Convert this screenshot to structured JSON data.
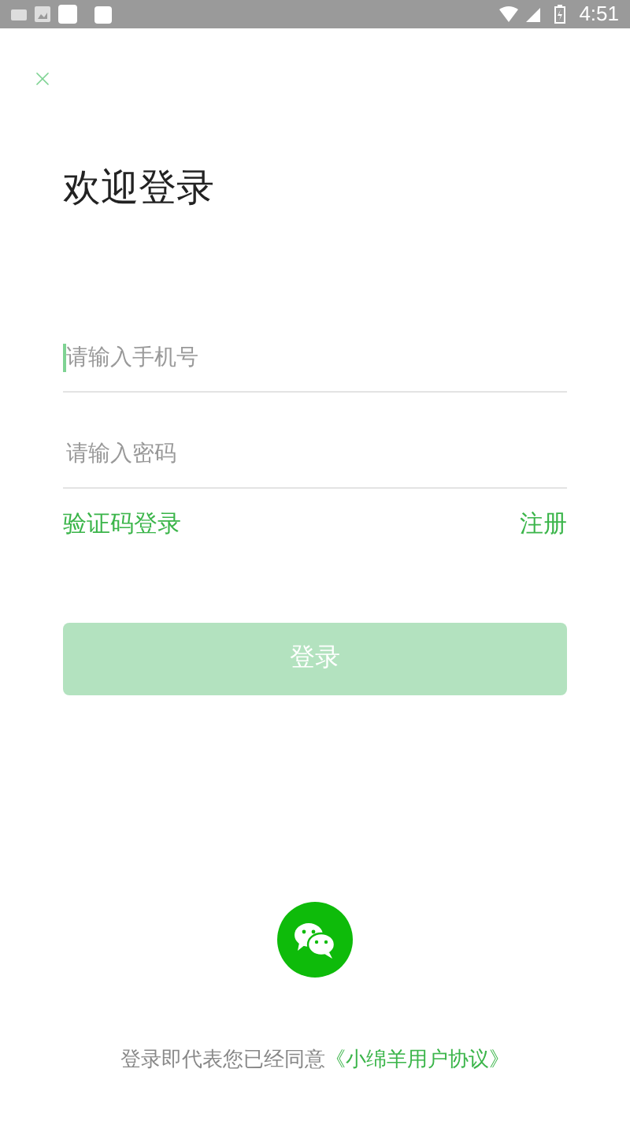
{
  "status_bar": {
    "time": "4:51"
  },
  "title": "欢迎登录",
  "fields": [
    {
      "placeholder": "请输入手机号",
      "focused": true
    },
    {
      "placeholder": "请输入密码",
      "focused": false
    }
  ],
  "links": {
    "left": "验证码登录",
    "right": "注册"
  },
  "login_button": {
    "label": "登录",
    "disabled": true
  },
  "agreement": {
    "text": "登录即代表您已经同意",
    "link": "《小绵羊用户协议》"
  }
}
